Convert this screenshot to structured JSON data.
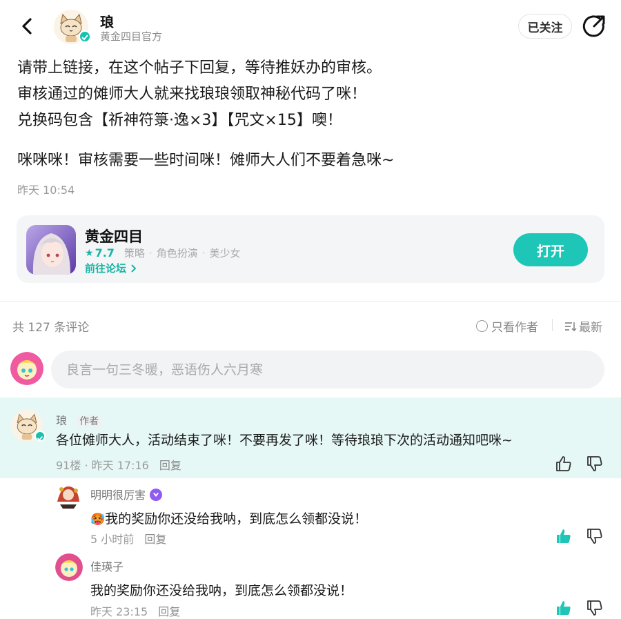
{
  "header": {
    "author_name": "琅",
    "author_subtitle": "黄金四目官方",
    "follow_label": "已关注"
  },
  "post": {
    "lines": [
      "请带上链接，在这个帖子下回复，等待推妖办的审核。",
      "审核通过的傩师大人就来找琅琅领取神秘代码了咪！",
      "兑换码包含【祈神符箓·逸×3】【咒文×15】噢！"
    ],
    "extra_line": "咪咪咪！审核需要一些时间咪！傩师大人们不要着急咪~",
    "time": "昨天 10:54"
  },
  "game": {
    "name": "黄金四目",
    "score": "7.7",
    "tags": [
      "策略",
      "角色扮演",
      "美少女"
    ],
    "forum_link": "前往论坛",
    "open_label": "打开"
  },
  "comments_bar": {
    "count_text": "共 127 条评论",
    "author_only_label": "只看作者",
    "sort_label": "最新"
  },
  "input": {
    "placeholder": "良言一句三冬暖，恶语伤人六月寒"
  },
  "comments": [
    {
      "name": "琅",
      "tag": "作者",
      "text": "各位傩师大人，活动结束了咪！不要再发了咪！等待琅琅下次的活动通知吧咪~",
      "meta": "91楼 · 昨天 17:16",
      "reply": "回复"
    }
  ],
  "replies": [
    {
      "name": "明明很厉害",
      "text": "我的奖励你还没给我呐，到底怎么领都没说！",
      "emoji": "🥵",
      "meta": "5 小时前",
      "reply": "回复",
      "liked": true
    },
    {
      "name": "佳瑛子",
      "text": "我的奖励你还没给我呐，到底怎么领都没说！",
      "meta": "昨天 23:15",
      "reply": "回复",
      "liked": true
    }
  ],
  "colors": {
    "accent": "#1dc6b6",
    "highlight_bg": "#e6f8f6",
    "vip": "#8f5bf0"
  }
}
